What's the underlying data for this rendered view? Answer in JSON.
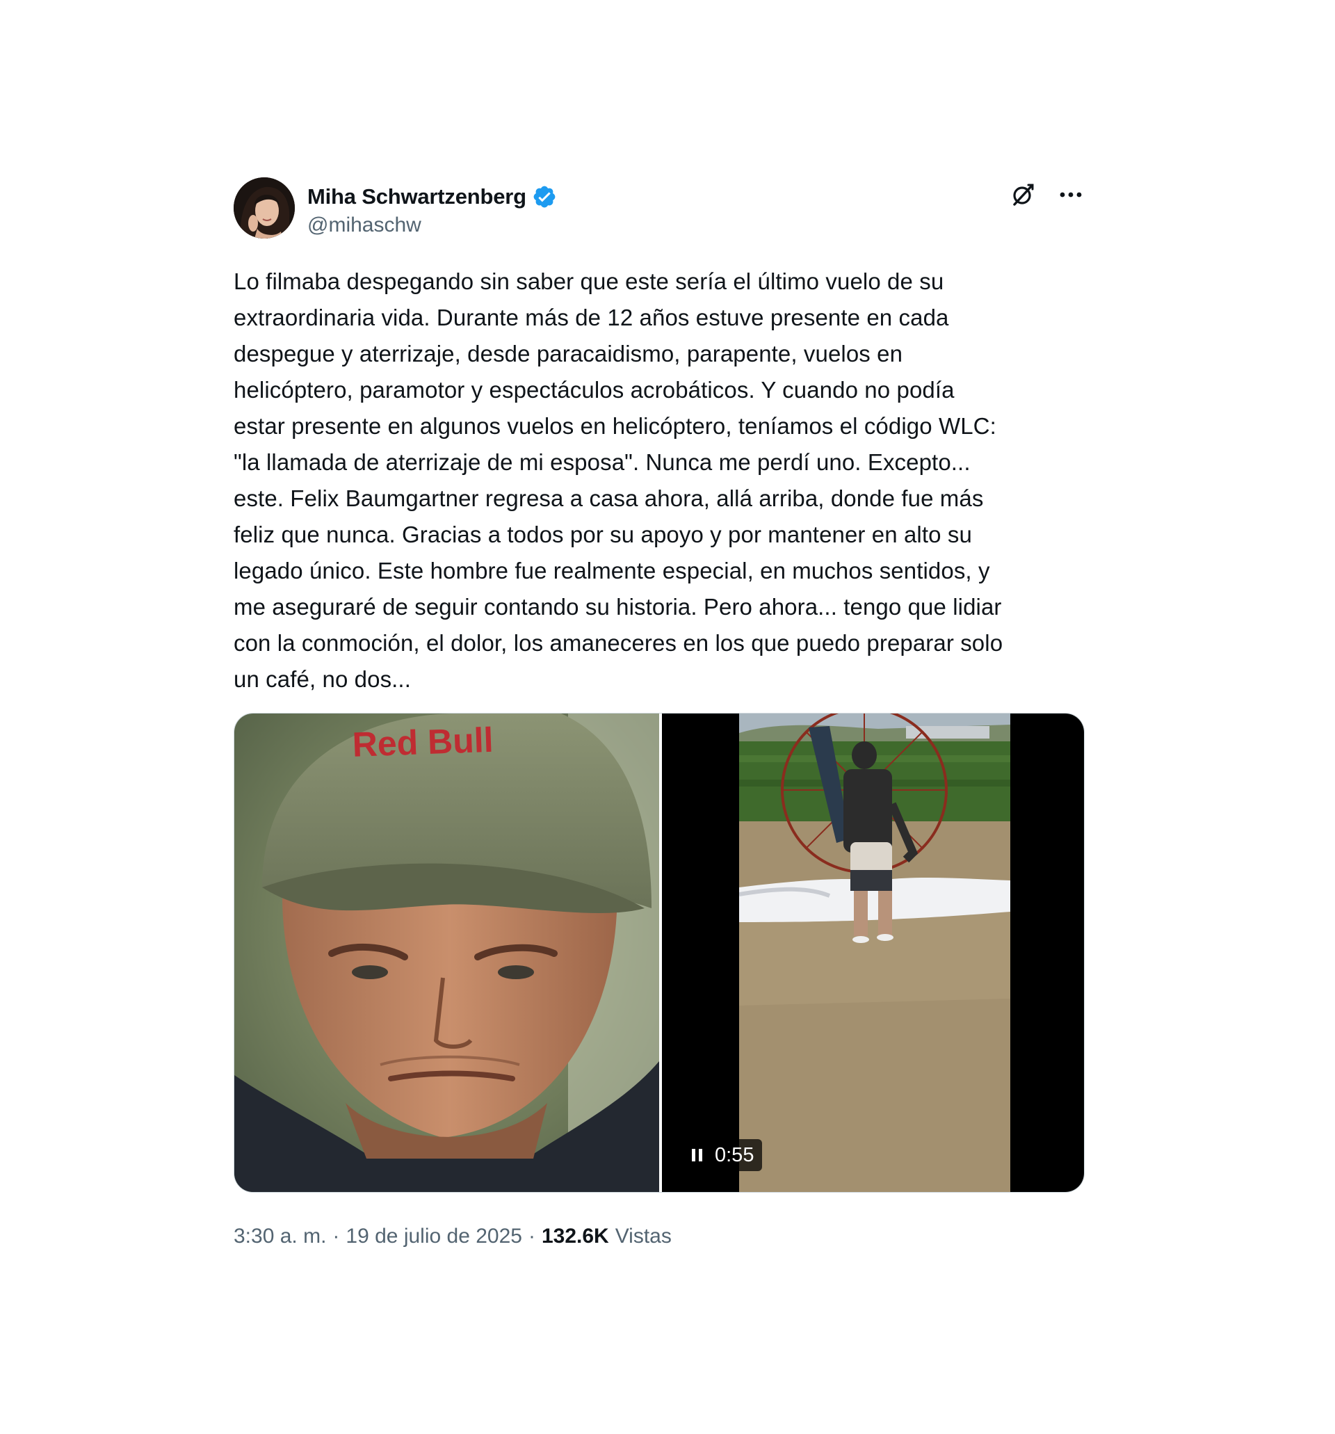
{
  "author": {
    "display_name": "Miha Schwartzenberg",
    "handle": "@mihaschw",
    "verified": true,
    "verified_color": "#1d9bf0"
  },
  "header_icons": {
    "grok": "grok-icon",
    "more": "more-icon"
  },
  "tweet": {
    "text": "Lo filmaba despegando sin saber que este sería el último vuelo de su\nextraordinaria vida. Durante más de 12 años estuve presente en cada\ndespegue y aterrizaje, desde paracaidismo, parapente, vuelos en\nhelicóptero, paramotor y espectáculos acrobáticos. Y cuando no podía\nestar presente en algunos vuelos en helicóptero, teníamos el código WLC:\n\"la llamada de aterrizaje de mi esposa\". Nunca me perdí uno. Excepto...\neste. Felix Baumgartner regresa a casa ahora, allá arriba, donde fue más\nfeliz que nunca. Gracias a todos por su apoyo y por mantener en alto su\nlegado único. Este hombre fue realmente especial, en muchos sentidos, y\nme aseguraré de seguir contando su historia. Pero ahora... tengo que lidiar\ncon la conmoción, el dolor, los amaneceres en los que puedo preparar solo\nun café, no dos..."
  },
  "media": {
    "photo": {
      "cap_text": "Red Bull"
    },
    "video": {
      "time": "0:55",
      "control_icon": "pause-icon"
    }
  },
  "footer": {
    "time": "3:30 a. m.",
    "separator": "·",
    "date": "19 de julio de 2025",
    "views_count": "132.6K",
    "views_label": "Vistas"
  }
}
